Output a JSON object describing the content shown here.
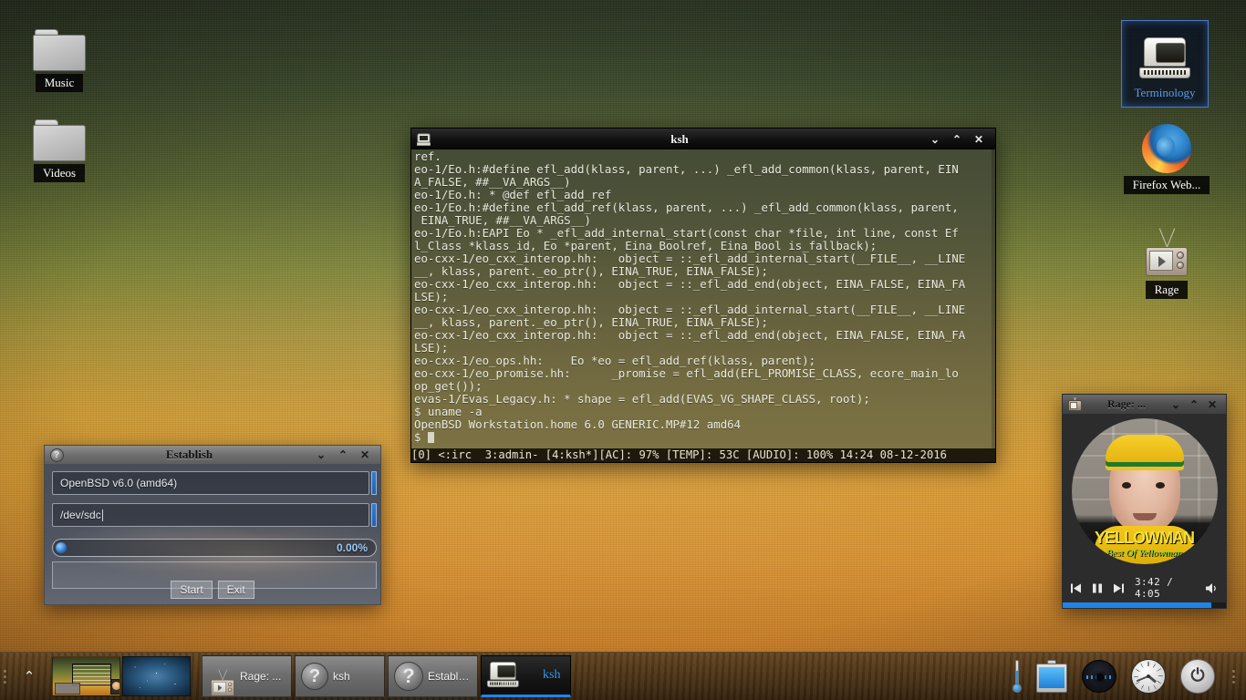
{
  "desktop": {
    "icons_left": [
      {
        "label": "Music",
        "icon": "folder-icon"
      },
      {
        "label": "Videos",
        "icon": "folder-icon"
      }
    ],
    "icons_right": [
      {
        "label": "Terminology",
        "icon": "crt-terminal-icon",
        "selected": true
      },
      {
        "label": "Firefox Web...",
        "icon": "firefox-icon",
        "selected": false
      },
      {
        "label": "Rage",
        "icon": "tv-icon",
        "selected": false
      }
    ]
  },
  "terminal_window": {
    "title": "ksh",
    "icon": "terminal-icon",
    "buttons": {
      "minimize": "⌄",
      "shade": "⌃",
      "close": "✕"
    },
    "lines": [
      "ref.",
      "eo-1/Eo.h:#define efl_add(klass, parent, ...) _efl_add_common(klass, parent, EIN",
      "A_FALSE, ##__VA_ARGS__)",
      "eo-1/Eo.h: * @def efl_add_ref",
      "eo-1/Eo.h:#define efl_add_ref(klass, parent, ...) _efl_add_common(klass, parent,",
      " EINA_TRUE, ##__VA_ARGS__)",
      "eo-1/Eo.h:EAPI Eo * _efl_add_internal_start(const char *file, int line, const Ef",
      "l_Class *klass_id, Eo *parent, Eina_Boolref, Eina_Bool is_fallback);",
      "eo-cxx-1/eo_cxx_interop.hh:   object = ::_efl_add_internal_start(__FILE__, __LINE",
      "__, klass, parent._eo_ptr(), EINA_TRUE, EINA_FALSE);",
      "eo-cxx-1/eo_cxx_interop.hh:   object = ::_efl_add_end(object, EINA_FALSE, EINA_FA",
      "LSE);",
      "eo-cxx-1/eo_cxx_interop.hh:   object = ::_efl_add_internal_start(__FILE__, __LINE",
      "__, klass, parent._eo_ptr(), EINA_TRUE, EINA_FALSE);",
      "eo-cxx-1/eo_cxx_interop.hh:   object = ::_efl_add_end(object, EINA_FALSE, EINA_FA",
      "LSE);",
      "eo-cxx-1/eo_ops.hh:    Eo *eo = efl_add_ref(klass, parent);",
      "eo-cxx-1/eo_promise.hh:      _promise = efl_add(EFL_PROMISE_CLASS, ecore_main_lo",
      "op_get());",
      "evas-1/Evas_Legacy.h: * shape = efl_add(EVAS_VG_SHAPE_CLASS, root);",
      "$ uname -a",
      "OpenBSD Workstation.home 6.0 GENERIC.MP#12 amd64"
    ],
    "prompt": "$ ",
    "status_line": "[0] <:irc  3:admin- [4:ksh*][AC]: 97% [TEMP]: 53C [AUDIO]: 100% 14:24 08-12-2016"
  },
  "establish_window": {
    "title": "Establish",
    "icon": "question-mark-icon",
    "buttons": {
      "minimize": "⌄",
      "shade": "⌃",
      "close": "✕"
    },
    "image_field_value": "OpenBSD v6.0 (amd64)",
    "device_field_value": "/dev/sdc",
    "progress_percent": "0.00%",
    "progress_value": 0,
    "start_label": "Start",
    "exit_label": "Exit"
  },
  "rage_window": {
    "title": "Rage: ...",
    "icon": "tv-icon",
    "buttons": {
      "minimize": "⌄",
      "shade": "⌃",
      "close": "✕"
    },
    "album_artist": "YELLOWMAN",
    "album_subtitle": "Best Of Yellowman",
    "time_current": "3:42",
    "time_total": "4:05",
    "time_display": "3:42 / 4:05",
    "seek_percent": 91,
    "controls": {
      "previous": "prev-track-icon",
      "pause": "pause-icon",
      "next": "next-track-icon",
      "volume": "volume-icon"
    }
  },
  "shelf": {
    "start_label": "⌃",
    "pager": {
      "desktops": 2,
      "active": 1
    },
    "tasks": [
      {
        "label": "Rage: ...",
        "icon": "tv-icon",
        "active": false
      },
      {
        "label": "ksh",
        "icon": "question-mark-icon",
        "active": false
      },
      {
        "label": "Establish",
        "icon": "question-mark-icon",
        "active": false
      },
      {
        "label": "ksh",
        "icon": "crt-terminal-icon",
        "active": true
      }
    ],
    "tray": [
      {
        "name": "temperature-icon"
      },
      {
        "name": "battery-icon"
      },
      {
        "name": "connection-icon"
      },
      {
        "name": "clock-icon"
      },
      {
        "name": "power-button-icon"
      }
    ]
  },
  "colors": {
    "accent_blue": "#1f84e8",
    "selection_blue": "#3d9bf0",
    "terminal_bg_top": "#454c35",
    "terminal_bg_bottom": "#7d7344",
    "shelf_brown": "#6d4a20"
  }
}
